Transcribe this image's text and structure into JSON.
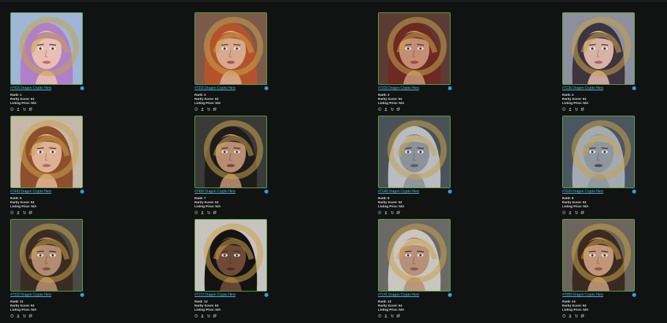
{
  "colors": {
    "background": "#111212",
    "card_border": "#5aa83d",
    "link": "#55c0e8",
    "verified": "#2fa3e6"
  },
  "icons": [
    "info-icon",
    "profile-icon",
    "cart-icon",
    "copy-icon"
  ],
  "cards": [
    {
      "name": "#7416 Dragon Crypto Hero",
      "rank": "Rank: 1",
      "rarity": "Rarity Score: 53",
      "price": "Listing Price: N/A",
      "portrait": {
        "bg": "#9fb6d6",
        "hair": "#b07fc9",
        "skin": "#e9bfb2",
        "lips": "#c86a7c"
      }
    },
    {
      "name": "#7315 Dragon Crypto Hero",
      "rank": "Rank: 2",
      "rarity": "Rarity Score: 53",
      "price": "Listing Price: N/A",
      "portrait": {
        "bg": "#7c5a4a",
        "hair": "#b4532a",
        "skin": "#d9a98c",
        "lips": "#a55a52"
      }
    },
    {
      "name": "#7318 Dragon Crypto Hero",
      "rank": "Rank: 3",
      "rarity": "Rarity Score: 53",
      "price": "Listing Price: N/A",
      "portrait": {
        "bg": "#5b3b33",
        "hair": "#6c2a22",
        "skin": "#c48e74",
        "lips": "#9b4e48"
      }
    },
    {
      "name": "#7135 Dragon Crypto Hero",
      "rank": "Rank: 4",
      "rarity": "Rarity Score: 53",
      "price": "Listing Price: N/A",
      "portrait": {
        "bg": "#8d8f9c",
        "hair": "#3d3440",
        "skin": "#d8b2a4",
        "lips": "#a76771"
      }
    },
    {
      "name": "#7443 Dragon Crypto Hero",
      "rank": "Rank: 5",
      "rarity": "Rarity Score: 53",
      "price": "Listing Price: N/A",
      "portrait": {
        "bg": "#c6b8a8",
        "hair": "#8e4f2c",
        "skin": "#e0b094",
        "lips": "#b36b62"
      }
    },
    {
      "name": "#7450 Dragon Crypto Hero",
      "rank": "Rank: 7",
      "rarity": "Rarity Score: 53",
      "price": "Listing Price: N/A",
      "portrait": {
        "bg": "#3a3a38",
        "hair": "#1e1c1b",
        "skin": "#b98d72",
        "lips": "#7a4a40"
      }
    },
    {
      "name": "#7148 Dragon Crypto Hero",
      "rank": "Rank: 8",
      "rarity": "Rarity Score: 53",
      "price": "Listing Price: N/A",
      "portrait": {
        "bg": "#4a5258",
        "hair": "#b9bcc0",
        "skin": "#8b9299",
        "lips": "#5a5f66"
      }
    },
    {
      "name": "#7029 Dragon Crypto Hero",
      "rank": "Rank: 9",
      "rarity": "Rarity Score: 53",
      "price": "Listing Price: N/A",
      "portrait": {
        "bg": "#4c5660",
        "hair": "#a4aab2",
        "skin": "#8e969e",
        "lips": "#4e5158"
      }
    },
    {
      "name": "#7332 Dragon Crypto Hero",
      "rank": "Rank: 11",
      "rarity": "Rarity Score: 53",
      "price": "Listing Price: N/A",
      "portrait": {
        "bg": "#4b4a46",
        "hair": "#3a2c22",
        "skin": "#b28b70",
        "lips": "#7f5447"
      }
    },
    {
      "name": "#7172 Dragon Crypto Hero",
      "rank": "Rank: 12",
      "rarity": "Rarity Score: 53",
      "price": "Listing Price: N/A",
      "portrait": {
        "bg": "#c7c3bf",
        "hair": "#151212",
        "skin": "#6e4a37",
        "lips": "#4d2e28"
      }
    },
    {
      "name": "#7141 Dragon Crypto Hero",
      "rank": "Rank: 13",
      "rarity": "Rarity Score: 53",
      "price": "Listing Price: N/A",
      "portrait": {
        "bg": "#6b6966",
        "hair": "#c9c6c0",
        "skin": "#b88f78",
        "lips": "#8a6053"
      }
    },
    {
      "name": "#7083 Dragon Crypto Hero",
      "rank": "Rank: 14",
      "rarity": "Rarity Score: 53",
      "price": "Listing Price: N/A",
      "portrait": {
        "bg": "#6c655e",
        "hair": "#3b2a20",
        "skin": "#c3967a",
        "lips": "#8c5c4e"
      }
    }
  ]
}
